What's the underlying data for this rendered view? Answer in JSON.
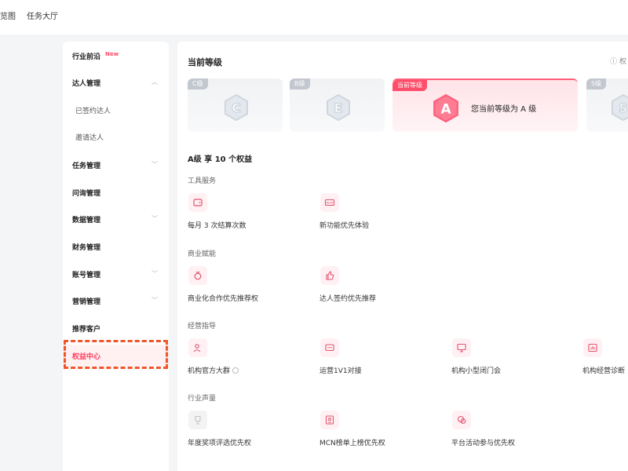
{
  "topbar": {
    "tabs": [
      "览图",
      "任务大厅"
    ]
  },
  "sidebar": {
    "items": [
      {
        "label": "行业前沿",
        "badge": "New"
      },
      {
        "label": "达人管理"
      },
      {
        "label": "已签约达人"
      },
      {
        "label": "邀请达人"
      },
      {
        "label": "任务管理"
      },
      {
        "label": "问询管理"
      },
      {
        "label": "数据管理"
      },
      {
        "label": "财务管理"
      },
      {
        "label": "账号管理"
      },
      {
        "label": "营销管理"
      },
      {
        "label": "推荐客户"
      },
      {
        "label": "权益中心"
      }
    ]
  },
  "main": {
    "current_level_title": "当前等级",
    "help_text": "ⓘ 权",
    "levels": [
      {
        "tag": "C级",
        "letter": "C"
      },
      {
        "tag": "B级",
        "letter": "E"
      },
      {
        "tag": "当前等级",
        "letter": "A",
        "text": "您当前等级为 A 级"
      },
      {
        "tag": "S级",
        "letter": "S"
      }
    ],
    "benefit_title": "A级 享 10 个权益",
    "categories": [
      {
        "title": "工具服务",
        "items": [
          {
            "label": "每月 3 次结算次数",
            "icon": "wallet-icon"
          },
          {
            "label": "新功能优先体验",
            "icon": "new-icon"
          }
        ]
      },
      {
        "title": "商业赋能",
        "items": [
          {
            "label": "商业化合作优先推荐权",
            "icon": "medal-icon"
          },
          {
            "label": "达人签约优先推荐",
            "icon": "thumbs-up-icon"
          }
        ]
      },
      {
        "title": "经营指导",
        "items": [
          {
            "label": "机构官方大群",
            "icon": "group-icon"
          },
          {
            "label": "运营1V1对接",
            "icon": "chat-icon"
          },
          {
            "label": "机构小型闭门会",
            "icon": "presentation-icon"
          },
          {
            "label": "机构经营诊断",
            "icon": "chart-icon"
          }
        ]
      },
      {
        "title": "行业声量",
        "items": [
          {
            "label": "年度奖项评选优先权",
            "icon": "trophy-icon"
          },
          {
            "label": "MCN榜单上榜优先权",
            "icon": "rank-icon"
          },
          {
            "label": "平台活动参与优先权",
            "icon": "activity-icon"
          }
        ]
      }
    ]
  },
  "colors": {
    "accent": "#ff3b5c",
    "highlight": "#f0552a"
  }
}
